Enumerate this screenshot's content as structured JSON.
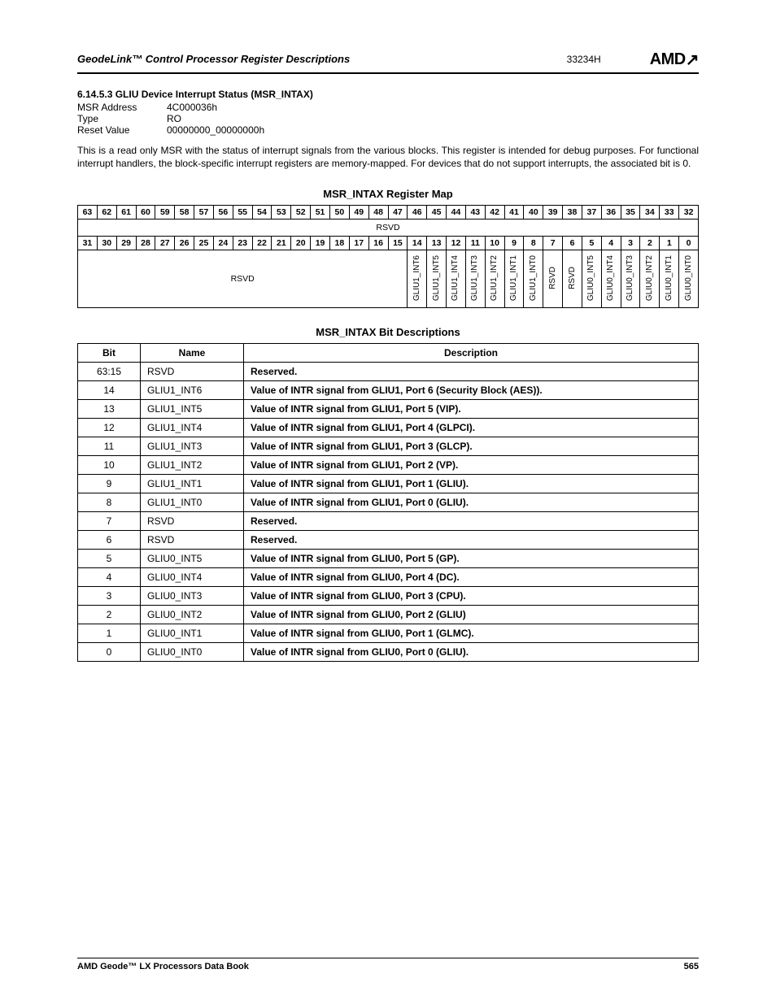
{
  "header": {
    "title": "GeodeLink™ Control Processor Register Descriptions",
    "docnum": "33234H",
    "logo": "AMD"
  },
  "section": {
    "num_title": "6.14.5.3   GLIU Device Interrupt Status (MSR_INTAX)",
    "msr_label": "MSR Address",
    "msr_value": "4C000036h",
    "type_label": "Type",
    "type_value": "RO",
    "reset_label": "Reset Value",
    "reset_value": "00000000_00000000h",
    "body": "This is a read only MSR with the status of interrupt signals from the various blocks. This register is intended for debug purposes. For functional interrupt handlers, the block-specific interrupt registers are memory-mapped. For devices that do not support interrupts, the associated bit is 0."
  },
  "regmap": {
    "title": "MSR_INTAX Register Map",
    "row1_bits": [
      "63",
      "62",
      "61",
      "60",
      "59",
      "58",
      "57",
      "56",
      "55",
      "54",
      "53",
      "52",
      "51",
      "50",
      "49",
      "48",
      "47",
      "46",
      "45",
      "44",
      "43",
      "42",
      "41",
      "40",
      "39",
      "38",
      "37",
      "36",
      "35",
      "34",
      "33",
      "32"
    ],
    "row1_label": "RSVD",
    "row2_bits": [
      "31",
      "30",
      "29",
      "28",
      "27",
      "26",
      "25",
      "24",
      "23",
      "22",
      "21",
      "20",
      "19",
      "18",
      "17",
      "16",
      "15",
      "14",
      "13",
      "12",
      "11",
      "10",
      "9",
      "8",
      "7",
      "6",
      "5",
      "4",
      "3",
      "2",
      "1",
      "0"
    ],
    "row2_labels_left": "RSVD",
    "row2_labels": [
      "GLIU1_INT6",
      "GLIU1_INT5",
      "GLIU1_INT4",
      "GLIU1_INT3",
      "GLIU1_INT2",
      "GLIU1_INT1",
      "GLIU1_INT0",
      "RSVD",
      "RSVD",
      "GLIU0_INT5",
      "GLIU0_INT4",
      "GLIU0_INT3",
      "GLIU0_INT2",
      "GLIU0_INT1",
      "GLIU0_INT0"
    ]
  },
  "bitdesc": {
    "title": "MSR_INTAX Bit Descriptions",
    "headers": [
      "Bit",
      "Name",
      "Description"
    ],
    "rows": [
      {
        "bit": "63:15",
        "name": "RSVD",
        "desc": "Reserved.",
        "bold": true
      },
      {
        "bit": "14",
        "name": "GLIU1_INT6",
        "desc": "Value of INTR signal from GLIU1, Port 6 (Security Block (AES)).",
        "bold": true
      },
      {
        "bit": "13",
        "name": "GLIU1_INT5",
        "desc": "Value of INTR signal from GLIU1, Port 5 (VIP).",
        "bold": true
      },
      {
        "bit": "12",
        "name": "GLIU1_INT4",
        "desc": "Value of INTR signal from GLIU1, Port 4 (GLPCI).",
        "bold": true
      },
      {
        "bit": "11",
        "name": "GLIU1_INT3",
        "desc": "Value of INTR signal from GLIU1, Port 3 (GLCP).",
        "bold": true
      },
      {
        "bit": "10",
        "name": "GLIU1_INT2",
        "desc": "Value of INTR signal from GLIU1, Port 2 (VP).",
        "bold": true
      },
      {
        "bit": "9",
        "name": "GLIU1_INT1",
        "desc": "Value of INTR signal from GLIU1, Port 1 (GLIU).",
        "bold": true
      },
      {
        "bit": "8",
        "name": "GLIU1_INT0",
        "desc": "Value of INTR signal from GLIU1, Port 0 (GLIU).",
        "bold": true
      },
      {
        "bit": "7",
        "name": "RSVD",
        "desc": "Reserved.",
        "bold": true
      },
      {
        "bit": "6",
        "name": "RSVD",
        "desc": "Reserved.",
        "bold": true
      },
      {
        "bit": "5",
        "name": "GLIU0_INT5",
        "desc": "Value of INTR signal from GLIU0, Port 5 (GP).",
        "bold": true
      },
      {
        "bit": "4",
        "name": "GLIU0_INT4",
        "desc": "Value of INTR signal from GLIU0, Port 4 (DC).",
        "bold": true
      },
      {
        "bit": "3",
        "name": "GLIU0_INT3",
        "desc": "Value of INTR signal from GLIU0, Port 3 (CPU).",
        "bold": true
      },
      {
        "bit": "2",
        "name": "GLIU0_INT2",
        "desc": "Value of INTR signal from GLIU0, Port 2 (GLIU)",
        "bold": true
      },
      {
        "bit": "1",
        "name": "GLIU0_INT1",
        "desc": "Value of INTR signal from GLIU0, Port 1 (GLMC).",
        "bold": true
      },
      {
        "bit": "0",
        "name": "GLIU0_INT0",
        "desc": "Value of INTR signal from GLIU0, Port 0 (GLIU).",
        "bold": true
      }
    ]
  },
  "footer": {
    "left": "AMD Geode™ LX Processors Data Book",
    "right": "565"
  }
}
